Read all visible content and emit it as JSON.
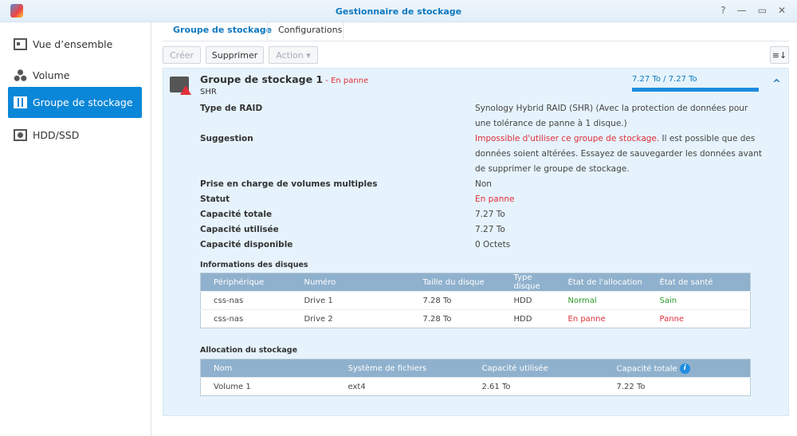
{
  "window": {
    "title": "Gestionnaire de stockage",
    "controls": [
      "?",
      "—",
      "▭",
      "✕"
    ]
  },
  "sidebar": {
    "items": [
      {
        "label": "Vue d’ensemble"
      },
      {
        "label": "Volume"
      },
      {
        "label": "Groupe de stockage"
      },
      {
        "label": "HDD/SSD"
      }
    ]
  },
  "tabs": [
    {
      "label": "Groupe de stockage"
    },
    {
      "label": "Configurations"
    }
  ],
  "toolbar": {
    "create": "Créer",
    "delete": "Supprimer",
    "action": "Action ▾",
    "sort": "≡↓"
  },
  "pool": {
    "name": "Groupe de stockage 1",
    "status_sep": " - ",
    "status": "En panne",
    "type": "SHR",
    "usage": "7.27 To / 7.27 To",
    "usage_fraction": 1.0,
    "collapse": "^",
    "details": [
      {
        "label": "Type de RAID",
        "value": "Synology Hybrid RAID (SHR) (Avec la protection de données pour une tolérance de panne à 1 disque.)"
      },
      {
        "label": "Suggestion",
        "value_red": "Impossible d'utiliser ce groupe de stockage.",
        "value": " Il est possible que des données soient altérées. Essayez de sauvegarder les données avant de supprimer le groupe de stockage."
      },
      {
        "label": "Prise en charge de volumes multiples",
        "value": "Non"
      },
      {
        "label": "Statut",
        "value": "En panne"
      },
      {
        "label": "Capacité totale",
        "value": "7.27 To"
      },
      {
        "label": "Capacité utilisée",
        "value": "7.27 To"
      },
      {
        "label": "Capacité disponible",
        "value": "0 Octets"
      }
    ]
  },
  "disks": {
    "title": "Informations des disques",
    "headers": [
      "Périphérique",
      "Numéro",
      "Taille du disque",
      "Type disque",
      "État de l'allocation",
      "État de santé"
    ],
    "rows": [
      [
        "css-nas",
        "Drive 1",
        "7.28 To",
        "HDD",
        "Normal",
        "Sain"
      ],
      [
        "css-nas",
        "Drive 2",
        "7.28 To",
        "HDD",
        "En panne",
        "Panne"
      ]
    ]
  },
  "allocation": {
    "title": "Allocation du stockage",
    "headers": [
      "Nom",
      "Système de fichiers",
      "Capacité utilisée",
      "Capacité totale"
    ],
    "info": "i",
    "rows": [
      [
        "Volume 1",
        "ext4",
        "2.61 To",
        "7.22 To"
      ]
    ]
  }
}
